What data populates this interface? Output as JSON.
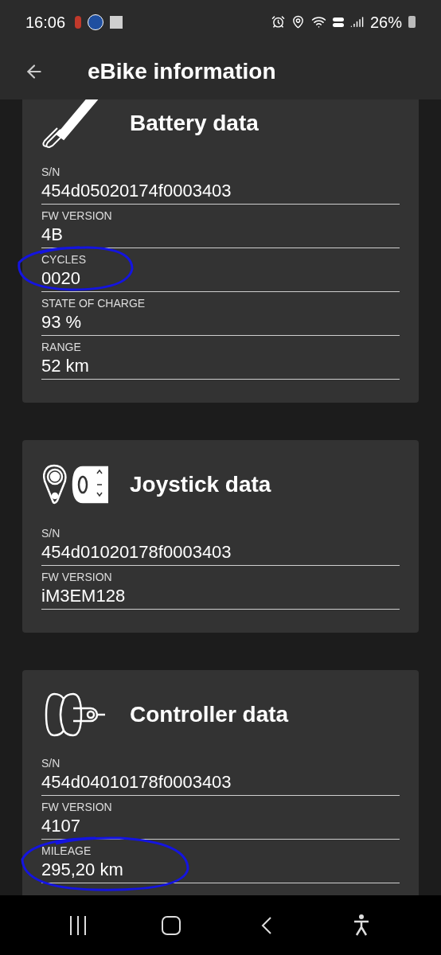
{
  "status_bar": {
    "time": "16:06",
    "battery": "26%"
  },
  "app_bar": {
    "title": "eBike information"
  },
  "sections": [
    {
      "kind": "battery",
      "title": "Battery data",
      "fields": [
        {
          "label": "S/N",
          "value": "454d05020174f0003403"
        },
        {
          "label": "FW VERSION",
          "value": "4B"
        },
        {
          "label": "CYCLES",
          "value": "0020"
        },
        {
          "label": "STATE OF CHARGE",
          "value": "93 %"
        },
        {
          "label": "RANGE",
          "value": "52 km"
        }
      ]
    },
    {
      "kind": "joystick",
      "title": "Joystick data",
      "fields": [
        {
          "label": "S/N",
          "value": "454d01020178f0003403"
        },
        {
          "label": "FW VERSION",
          "value": "iM3EM128"
        }
      ]
    },
    {
      "kind": "controller",
      "title": "Controller data",
      "fields": [
        {
          "label": "S/N",
          "value": "454d04010178f0003403"
        },
        {
          "label": "FW VERSION",
          "value": "4107"
        },
        {
          "label": "MILEAGE",
          "value": "295,20 km"
        }
      ]
    }
  ]
}
